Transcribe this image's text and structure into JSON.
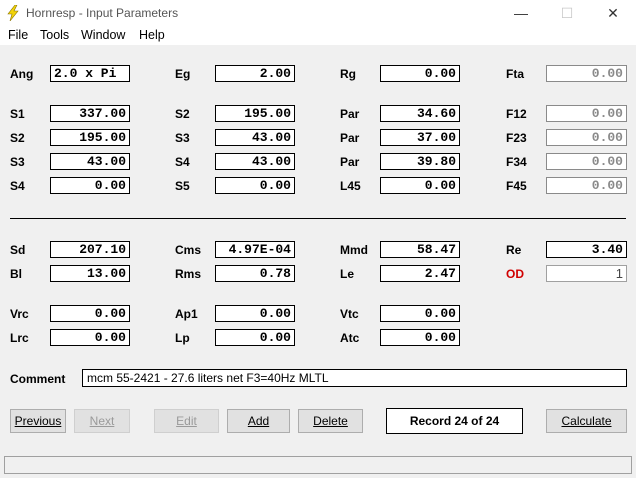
{
  "window": {
    "title": "Hornresp - Input Parameters",
    "minimize": "—",
    "maximize": "☐",
    "close": "✕",
    "icon": "lightning-icon",
    "icon_color": "#f2d40a"
  },
  "menu": [
    "File",
    "Tools",
    "Window",
    "Help"
  ],
  "labels": {
    "ang": "Ang",
    "eg": "Eg",
    "rg": "Rg",
    "fta": "Fta",
    "s1": "S1",
    "s2a": "S2",
    "par1": "Par",
    "f12": "F12",
    "s2b": "S2",
    "s3a": "S3",
    "par2": "Par",
    "f23": "F23",
    "s3b": "S3",
    "s4a": "S4",
    "par3": "Par",
    "f34": "F34",
    "s4b": "S4",
    "s5": "S5",
    "l45": "L45",
    "f45": "F45",
    "sd": "Sd",
    "cms": "Cms",
    "mmd": "Mmd",
    "re": "Re",
    "bl": "Bl",
    "rms": "Rms",
    "le": "Le",
    "od": "OD",
    "vrc": "Vrc",
    "ap1": "Ap1",
    "vtc": "Vtc",
    "lrc": "Lrc",
    "lp": "Lp",
    "atc": "Atc",
    "comment": "Comment"
  },
  "values": {
    "ang": "2.0 x Pi",
    "eg": "2.00",
    "rg": "0.00",
    "fta": "0.00",
    "s1": "337.00",
    "s2a": "195.00",
    "par1": "34.60",
    "f12": "0.00",
    "s2b": "195.00",
    "s3a": "43.00",
    "par2": "37.00",
    "f23": "0.00",
    "s3b": "43.00",
    "s4a": "43.00",
    "par3": "39.80",
    "f34": "0.00",
    "s4b": "0.00",
    "s5": "0.00",
    "l45": "0.00",
    "f45": "0.00",
    "sd": "207.10",
    "cms": "4.97E-04",
    "mmd": "58.47",
    "re": "3.40",
    "bl": "13.00",
    "rms": "0.78",
    "le": "2.47",
    "od": "1",
    "vrc": "0.00",
    "ap1": "0.00",
    "vtc": "0.00",
    "lrc": "0.00",
    "lp": "0.00",
    "atc": "0.00",
    "comment": "mcm 55-2421 - 27.6 liters net F3=40Hz MLTL"
  },
  "buttons": {
    "previous": "Previous",
    "next": "Next",
    "edit": "Edit",
    "add": "Add",
    "delete": "Delete",
    "calculate": "Calculate"
  },
  "record": "Record 24 of 24",
  "colors": {
    "od_label": "#d00000",
    "disabled_text": "#8a8a8a"
  }
}
